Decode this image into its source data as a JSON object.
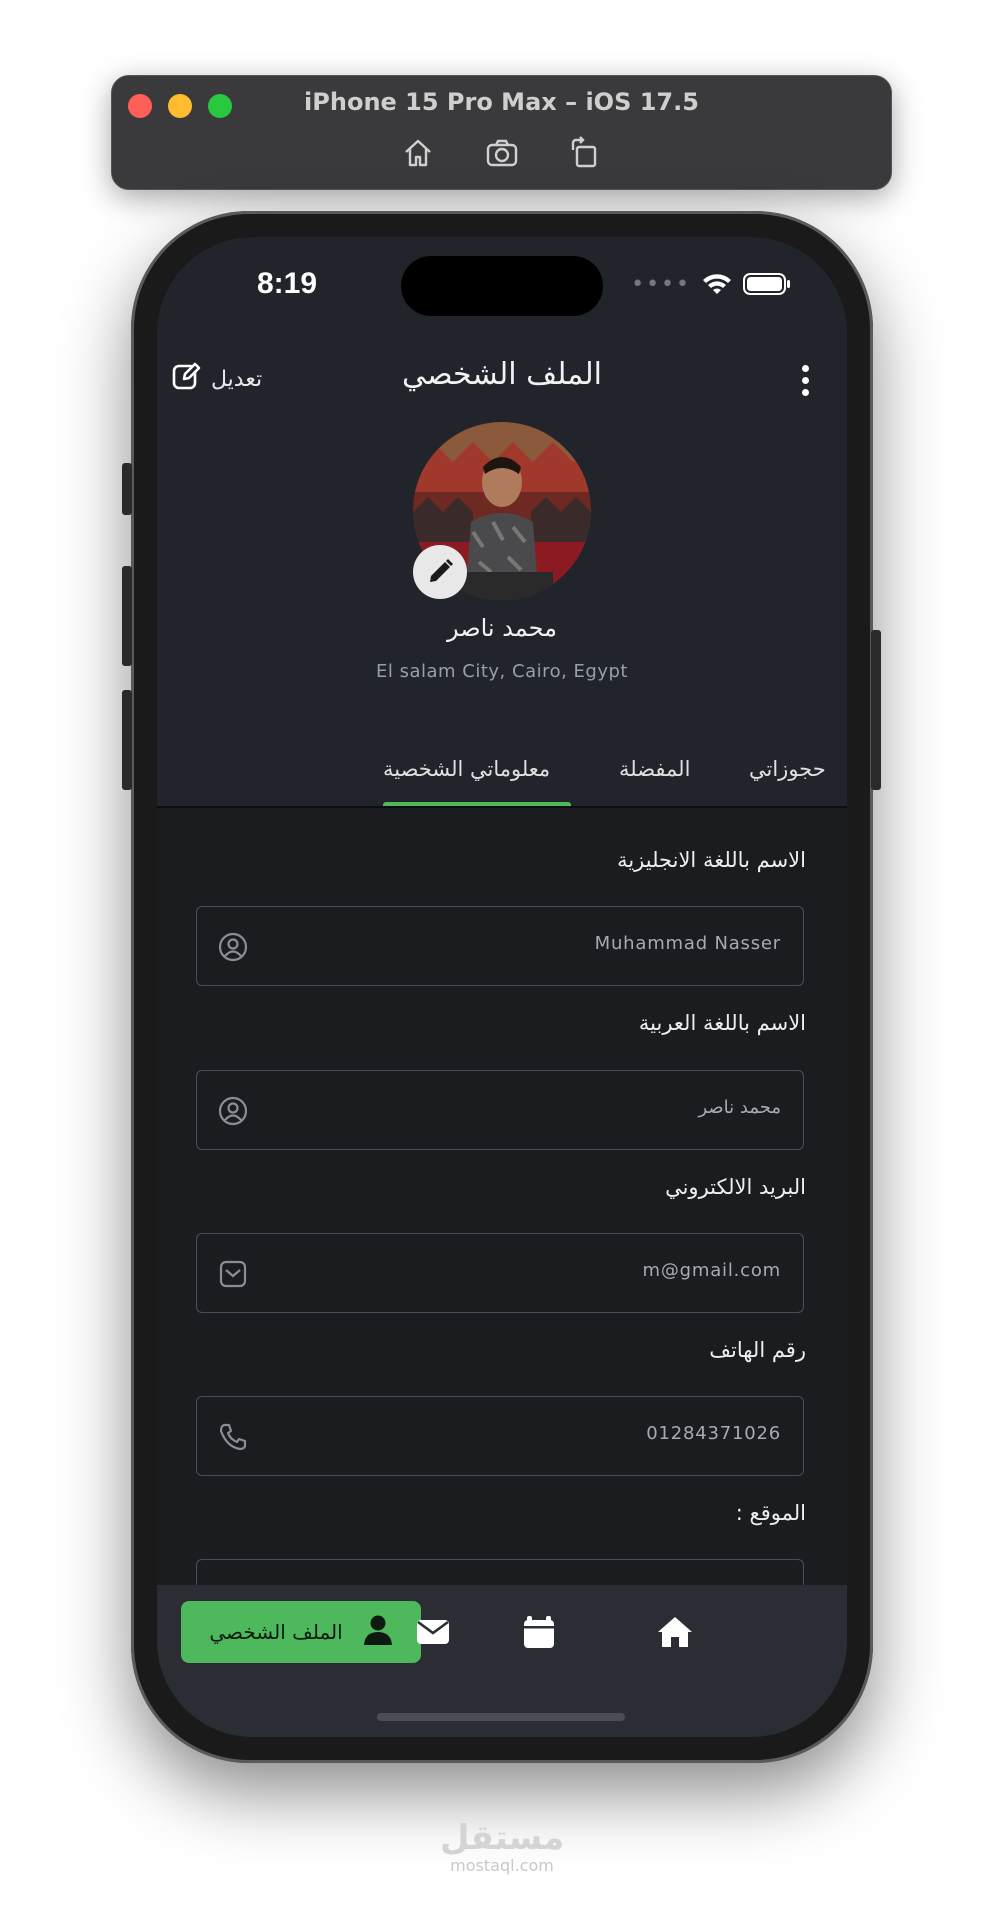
{
  "simulator": {
    "title": "iPhone 15 Pro Max – iOS 17.5",
    "tools": [
      "home-icon",
      "screenshot-icon",
      "rotate-icon"
    ]
  },
  "status_bar": {
    "time": "8:19",
    "icons": [
      "signal-dots-icon",
      "wifi-icon",
      "battery-icon"
    ]
  },
  "header": {
    "edit_label": "تعديل",
    "title": "الملف الشخصي"
  },
  "profile": {
    "name": "محمد ناصر",
    "location": "El salam City, Cairo, Egypt"
  },
  "tabs": [
    {
      "label": "معلوماتي الشخصية",
      "active": true
    },
    {
      "label": "المفضلة",
      "active": false
    },
    {
      "label": "حجوزاتي",
      "active": false
    }
  ],
  "form": {
    "fields": [
      {
        "label": "الاسم باللغة الانجليزية",
        "value": "Muhammad Nasser",
        "icon": "user-circle-icon"
      },
      {
        "label": "الاسم باللغة العربية",
        "value": "محمد ناصر",
        "icon": "user-circle-icon"
      },
      {
        "label": "البريد الالكتروني",
        "value": "m@gmail.com",
        "icon": "mail-icon"
      },
      {
        "label": "رقم الهاتف",
        "value": "01284371026",
        "icon": "phone-icon"
      },
      {
        "label": "الموقع :",
        "value": "",
        "icon": ""
      }
    ]
  },
  "bottom_nav": {
    "active_label": "الملف الشخصي",
    "items": [
      "profile-icon",
      "mail-icon",
      "calendar-icon",
      "home-icon"
    ]
  },
  "colors": {
    "accent": "#4db85c",
    "background": "#21252b",
    "content_background": "#1a1c20"
  },
  "watermark": {
    "logo": "مستقل",
    "url": "mostaql.com"
  }
}
